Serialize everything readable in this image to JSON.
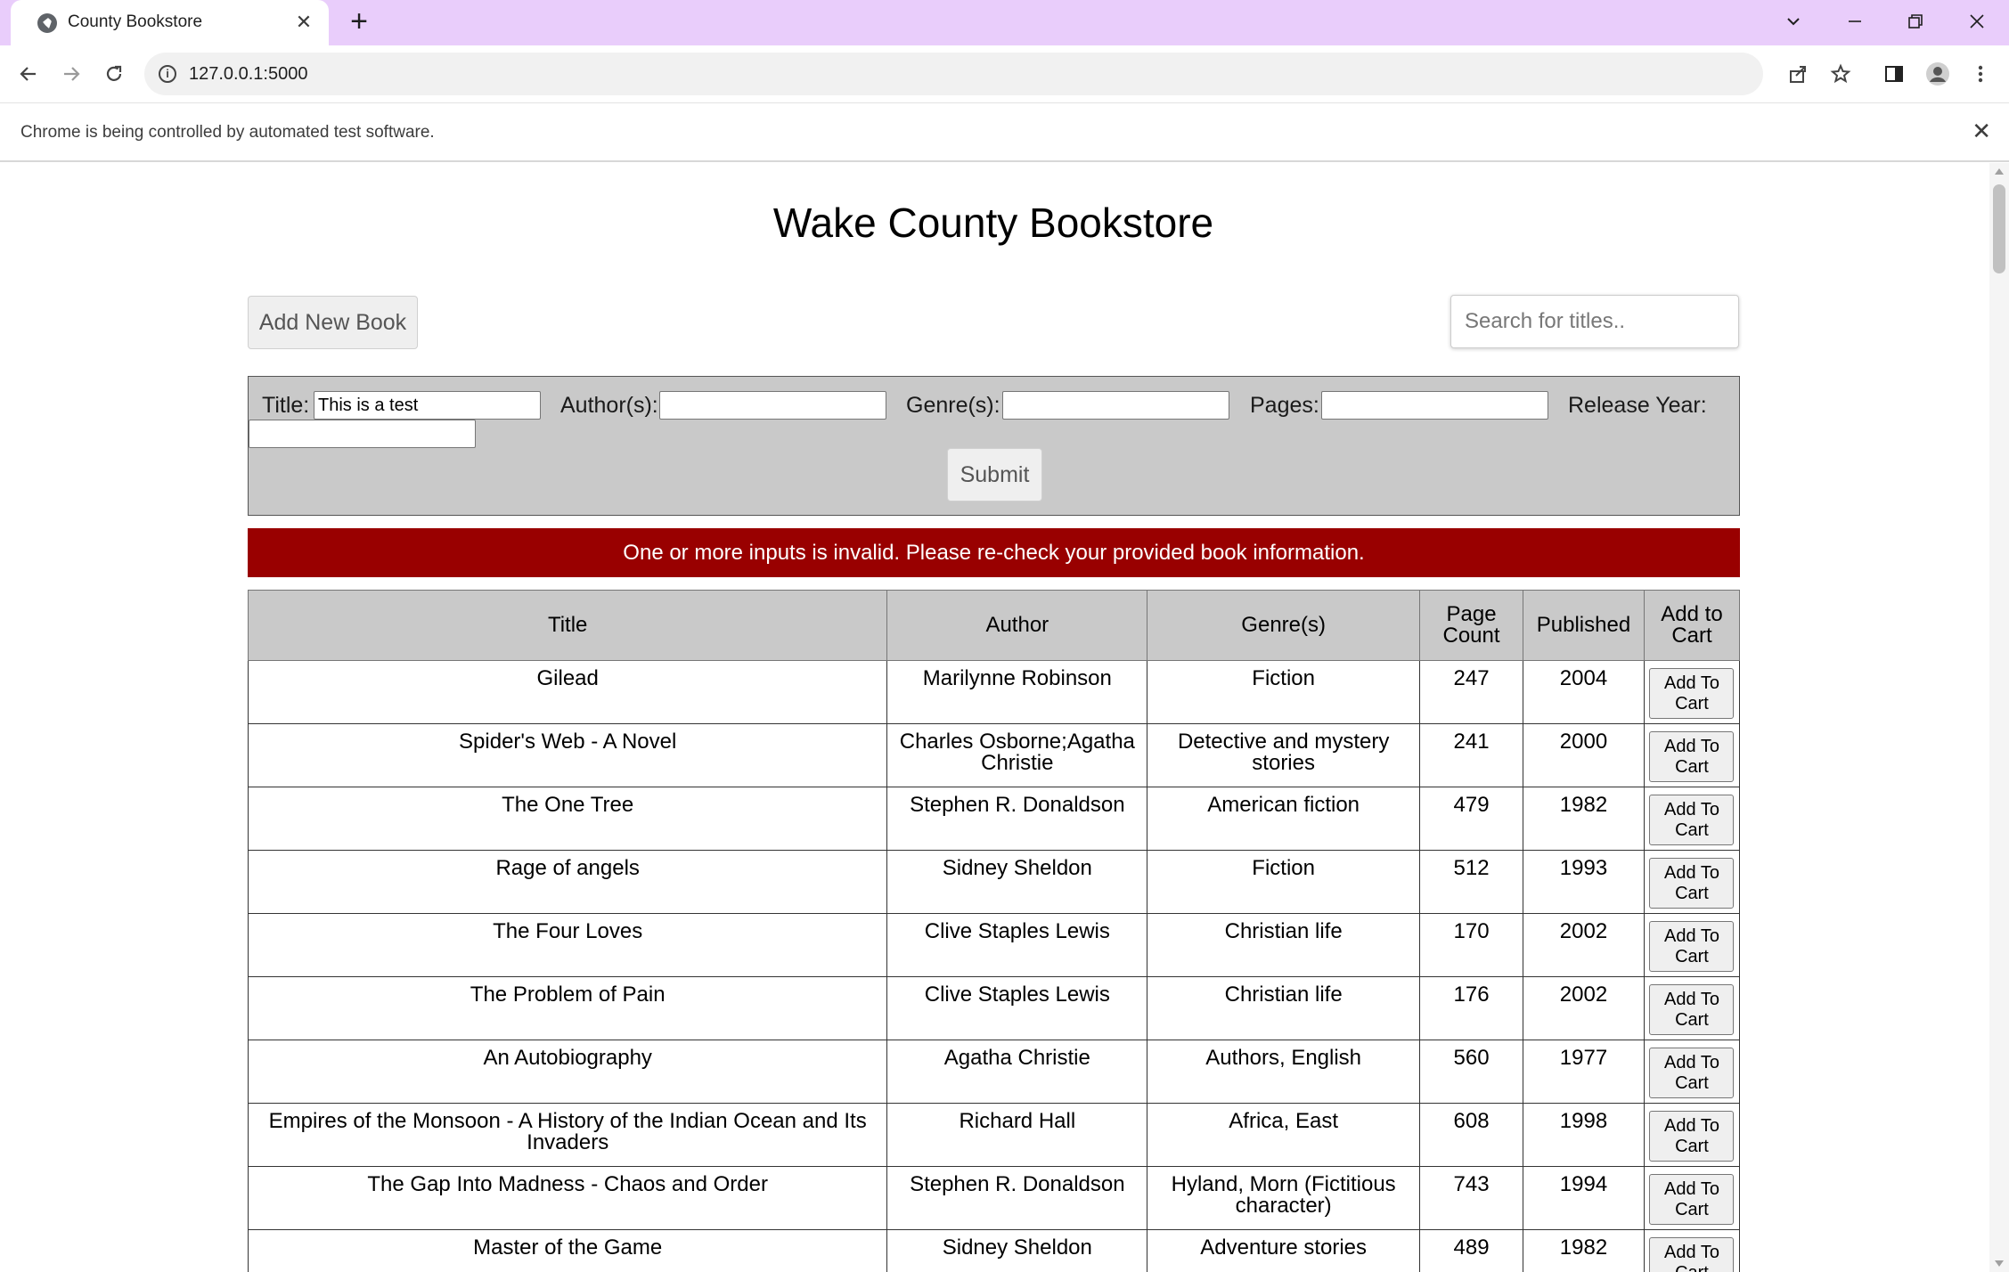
{
  "browser": {
    "tab_title": "County Bookstore",
    "url": "127.0.0.1:5000",
    "infobar_message": "Chrome is being controlled by automated test software."
  },
  "page": {
    "title": "Wake County Bookstore",
    "add_book_label": "Add New Book",
    "search_placeholder": "Search for titles..",
    "form": {
      "title_label": "Title:",
      "title_value": "This is a test",
      "authors_label": "Author(s):",
      "authors_value": "",
      "genres_label": "Genre(s):",
      "genres_value": "",
      "pages_label": "Pages:",
      "pages_value": "",
      "year_label": "Release Year:",
      "year_value": "",
      "submit_label": "Submit"
    },
    "error_message": "One or more inputs is invalid. Please re-check your provided book information."
  },
  "table": {
    "headers": [
      "Title",
      "Author",
      "Genre(s)",
      "Page Count",
      "Published",
      "Add to Cart"
    ],
    "cart_button_label": "Add To Cart",
    "rows": [
      {
        "title": "Gilead",
        "author": "Marilynne Robinson",
        "genre": "Fiction",
        "pages": "247",
        "published": "2004"
      },
      {
        "title": "Spider's Web - A Novel",
        "author": "Charles Osborne;Agatha Christie",
        "genre": "Detective and mystery stories",
        "pages": "241",
        "published": "2000"
      },
      {
        "title": "The One Tree",
        "author": "Stephen R. Donaldson",
        "genre": "American fiction",
        "pages": "479",
        "published": "1982"
      },
      {
        "title": "Rage of angels",
        "author": "Sidney Sheldon",
        "genre": "Fiction",
        "pages": "512",
        "published": "1993"
      },
      {
        "title": "The Four Loves",
        "author": "Clive Staples Lewis",
        "genre": "Christian life",
        "pages": "170",
        "published": "2002"
      },
      {
        "title": "The Problem of Pain",
        "author": "Clive Staples Lewis",
        "genre": "Christian life",
        "pages": "176",
        "published": "2002"
      },
      {
        "title": "An Autobiography",
        "author": "Agatha Christie",
        "genre": "Authors, English",
        "pages": "560",
        "published": "1977"
      },
      {
        "title": "Empires of the Monsoon - A History of the Indian Ocean and Its Invaders",
        "author": "Richard Hall",
        "genre": "Africa, East",
        "pages": "608",
        "published": "1998"
      },
      {
        "title": "The Gap Into Madness - Chaos and Order",
        "author": "Stephen R. Donaldson",
        "genre": "Hyland, Morn (Fictitious character)",
        "pages": "743",
        "published": "1994"
      },
      {
        "title": "Master of the Game",
        "author": "Sidney Sheldon",
        "genre": "Adventure stories",
        "pages": "489",
        "published": "1982"
      }
    ]
  },
  "colors": {
    "tabstrip": "#e9cdfb",
    "error_banner": "#990000",
    "panel": "#c9c9c9"
  }
}
